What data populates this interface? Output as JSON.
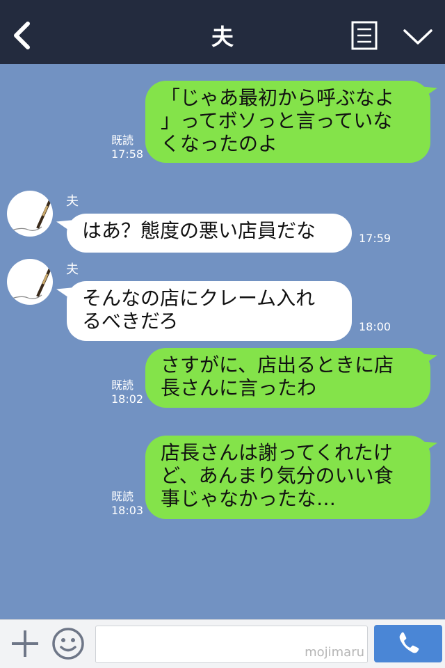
{
  "header": {
    "title": "夫",
    "back_icon": "chevron-left-icon",
    "menu_icon": "menu-list-icon",
    "collapse_icon": "chevron-down-icon"
  },
  "messages": [
    {
      "side": "out",
      "text": "「じゃあ最初から呼ぶなよ\n」ってボソっと言っていな\nくなったのよ",
      "read": "既読",
      "time": "17:58"
    },
    {
      "side": "in",
      "sender": "夫",
      "text": "はあ？態度の悪い店員だな",
      "time": "17:59"
    },
    {
      "side": "in",
      "sender": "夫",
      "text": "そんなの店にクレーム入れ\nるべきだろ",
      "time": "18:00"
    },
    {
      "side": "out",
      "text": "さすがに、店出るときに店\n長さんに言ったわ",
      "read": "既読",
      "time": "18:02"
    },
    {
      "side": "out",
      "text": "店長さんは謝ってくれたけ\nど、あんまり気分のいい食\n事じゃなかったな…",
      "read": "既読",
      "time": "18:03"
    }
  ],
  "footer": {
    "input_value": "",
    "watermark": "mojimaru",
    "plus_icon": "plus-icon",
    "emoji_icon": "emoji-icon",
    "call_icon": "phone-icon"
  },
  "colors": {
    "header_bg": "#232b3e",
    "chat_bg": "#7292c2",
    "outgoing_bubble": "#84e34a",
    "incoming_bubble": "#ffffff",
    "call_button": "#4a86d6"
  }
}
